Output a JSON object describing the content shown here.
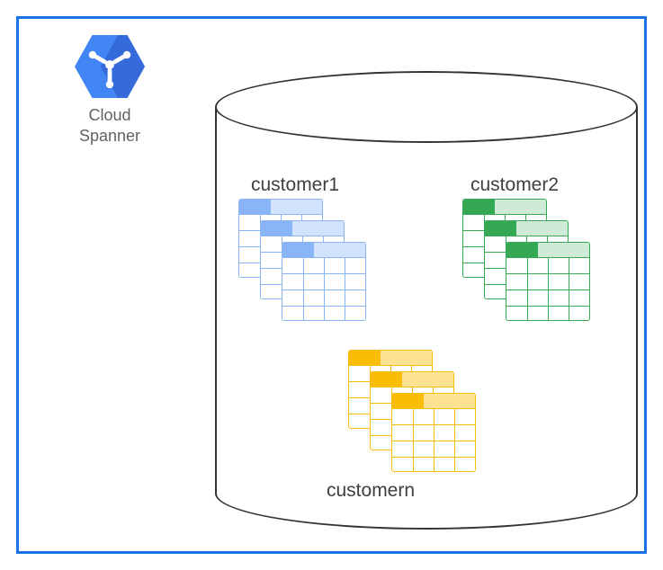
{
  "product": {
    "name": "Cloud\nSpanner",
    "icon_name": "cloud-spanner-icon"
  },
  "cylinder": {
    "customers": [
      {
        "id": "customer1",
        "label": "customer1",
        "color": "blue",
        "colors": {
          "stroke": "#8ab4f8",
          "header": "#d2e3fc",
          "tab": "#8ab4f8"
        }
      },
      {
        "id": "customer2",
        "label": "customer2",
        "color": "green",
        "colors": {
          "stroke": "#34a853",
          "header": "#ceead6",
          "tab": "#34a853"
        }
      },
      {
        "id": "customern",
        "label": "customern",
        "color": "yellow",
        "colors": {
          "stroke": "#fbbc04",
          "header": "#fde293",
          "tab": "#fbbc04"
        }
      }
    ]
  },
  "frame_color": "#1a73e8"
}
